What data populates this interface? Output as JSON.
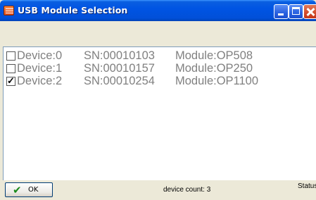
{
  "window": {
    "title": "USB Module Selection"
  },
  "devices": [
    {
      "device": "Device:0",
      "sn": "SN:00010103",
      "module": "Module:OP508",
      "checked": false
    },
    {
      "device": "Device:1",
      "sn": "SN:00010157",
      "module": "Module:OP250",
      "checked": false
    },
    {
      "device": "Device:2",
      "sn": "SN:00010254",
      "module": "Module:OP1100",
      "checked": true
    }
  ],
  "statusbar": {
    "ok_label": "OK",
    "device_count": "device count: 3",
    "status_label": "Status"
  }
}
